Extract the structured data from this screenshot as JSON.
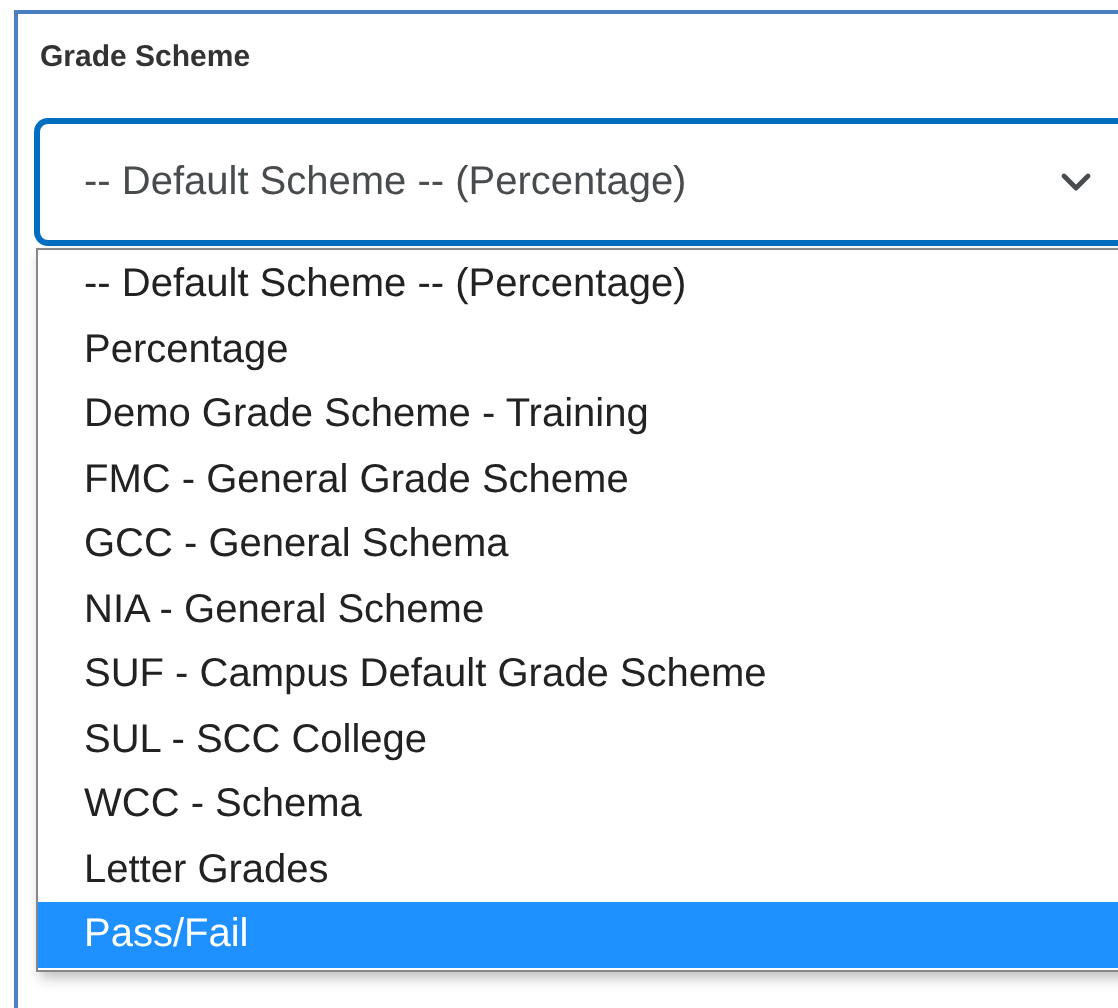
{
  "field": {
    "label": "Grade Scheme",
    "value": "-- Default Scheme -- (Percentage)",
    "expanded": true
  },
  "options": [
    {
      "label": "-- Default Scheme -- (Percentage)",
      "selected": false
    },
    {
      "label": "Percentage",
      "selected": false
    },
    {
      "label": "Demo Grade Scheme - Training",
      "selected": false
    },
    {
      "label": "FMC - General Grade Scheme",
      "selected": false
    },
    {
      "label": "GCC - General Schema",
      "selected": false
    },
    {
      "label": "NIA - General Scheme",
      "selected": false
    },
    {
      "label": "SUF - Campus Default Grade Scheme",
      "selected": false
    },
    {
      "label": "SUL - SCC College",
      "selected": false
    },
    {
      "label": "WCC - Schema",
      "selected": false
    },
    {
      "label": "Letter Grades",
      "selected": false
    },
    {
      "label": "Pass/Fail",
      "selected": true
    }
  ]
}
